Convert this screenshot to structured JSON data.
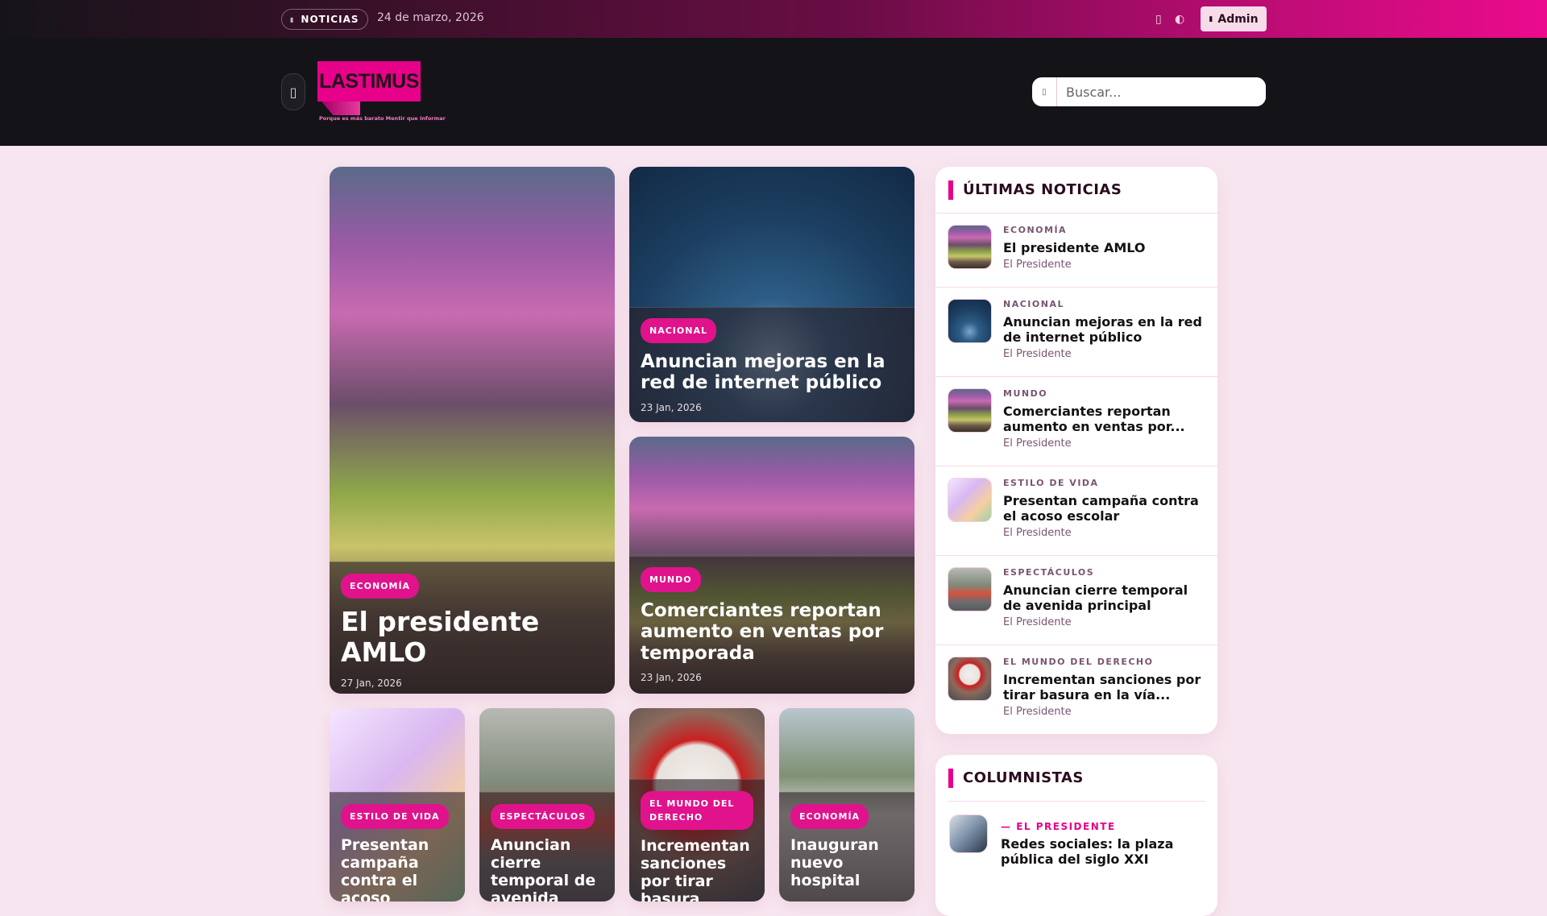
{
  "topbar": {
    "section_label": "NOTICIAS",
    "date": "24 de marzo, 2026",
    "admin_label": "Admin"
  },
  "header": {
    "logo_text": "LASTIMUS",
    "logo_tagline": "Porque es más barato Mentir que Informar",
    "search_placeholder": "Buscar..."
  },
  "featured": [
    {
      "category": "ECONOMÍA",
      "title": "El presidente AMLO",
      "date": "27 Jan, 2026"
    },
    {
      "category": "NACIONAL",
      "title": "Anuncian mejoras en la red de internet público",
      "date": "23 Jan, 2026"
    },
    {
      "category": "MUNDO",
      "title": "Comerciantes reportan aumento en ventas por temporada",
      "date": "23 Jan, 2026"
    }
  ],
  "grid": [
    {
      "category": "ESTILO DE VIDA",
      "title": "Presentan campaña contra el acoso escolar"
    },
    {
      "category": "ESPECTÁCULOS",
      "title": "Anuncian cierre temporal de avenida principal"
    },
    {
      "category": "EL MUNDO DEL DERECHO",
      "title": "Incrementan sanciones por tirar basura"
    },
    {
      "category": "ECONOMÍA",
      "title": "Inauguran nuevo hospital"
    }
  ],
  "latest": {
    "heading": "ÚLTIMAS NOTICIAS",
    "items": [
      {
        "category": "ECONOMÍA",
        "title": "El presidente AMLO",
        "author": "El Presidente"
      },
      {
        "category": "NACIONAL",
        "title": "Anuncian mejoras en la red de internet público",
        "author": "El Presidente"
      },
      {
        "category": "MUNDO",
        "title": "Comerciantes reportan aumento en ventas por...",
        "author": "El Presidente"
      },
      {
        "category": "ESTILO DE VIDA",
        "title": "Presentan campaña contra el acoso escolar",
        "author": "El Presidente"
      },
      {
        "category": "ESPECTÁCULOS",
        "title": "Anuncian cierre temporal de avenida principal",
        "author": "El Presidente"
      },
      {
        "category": "EL MUNDO DEL DERECHO",
        "title": "Incrementan sanciones por tirar basura en la vía...",
        "author": "El Presidente"
      }
    ]
  },
  "columnists": {
    "heading": "COLUMNISTAS",
    "items": [
      {
        "author": "EL PRESIDENTE",
        "title": "Redes sociales: la plaza pública del siglo XXI"
      }
    ]
  },
  "colors": {
    "accent": "#e6008a",
    "header_bg": "#141318",
    "page_bg": "#f7e6ef"
  }
}
